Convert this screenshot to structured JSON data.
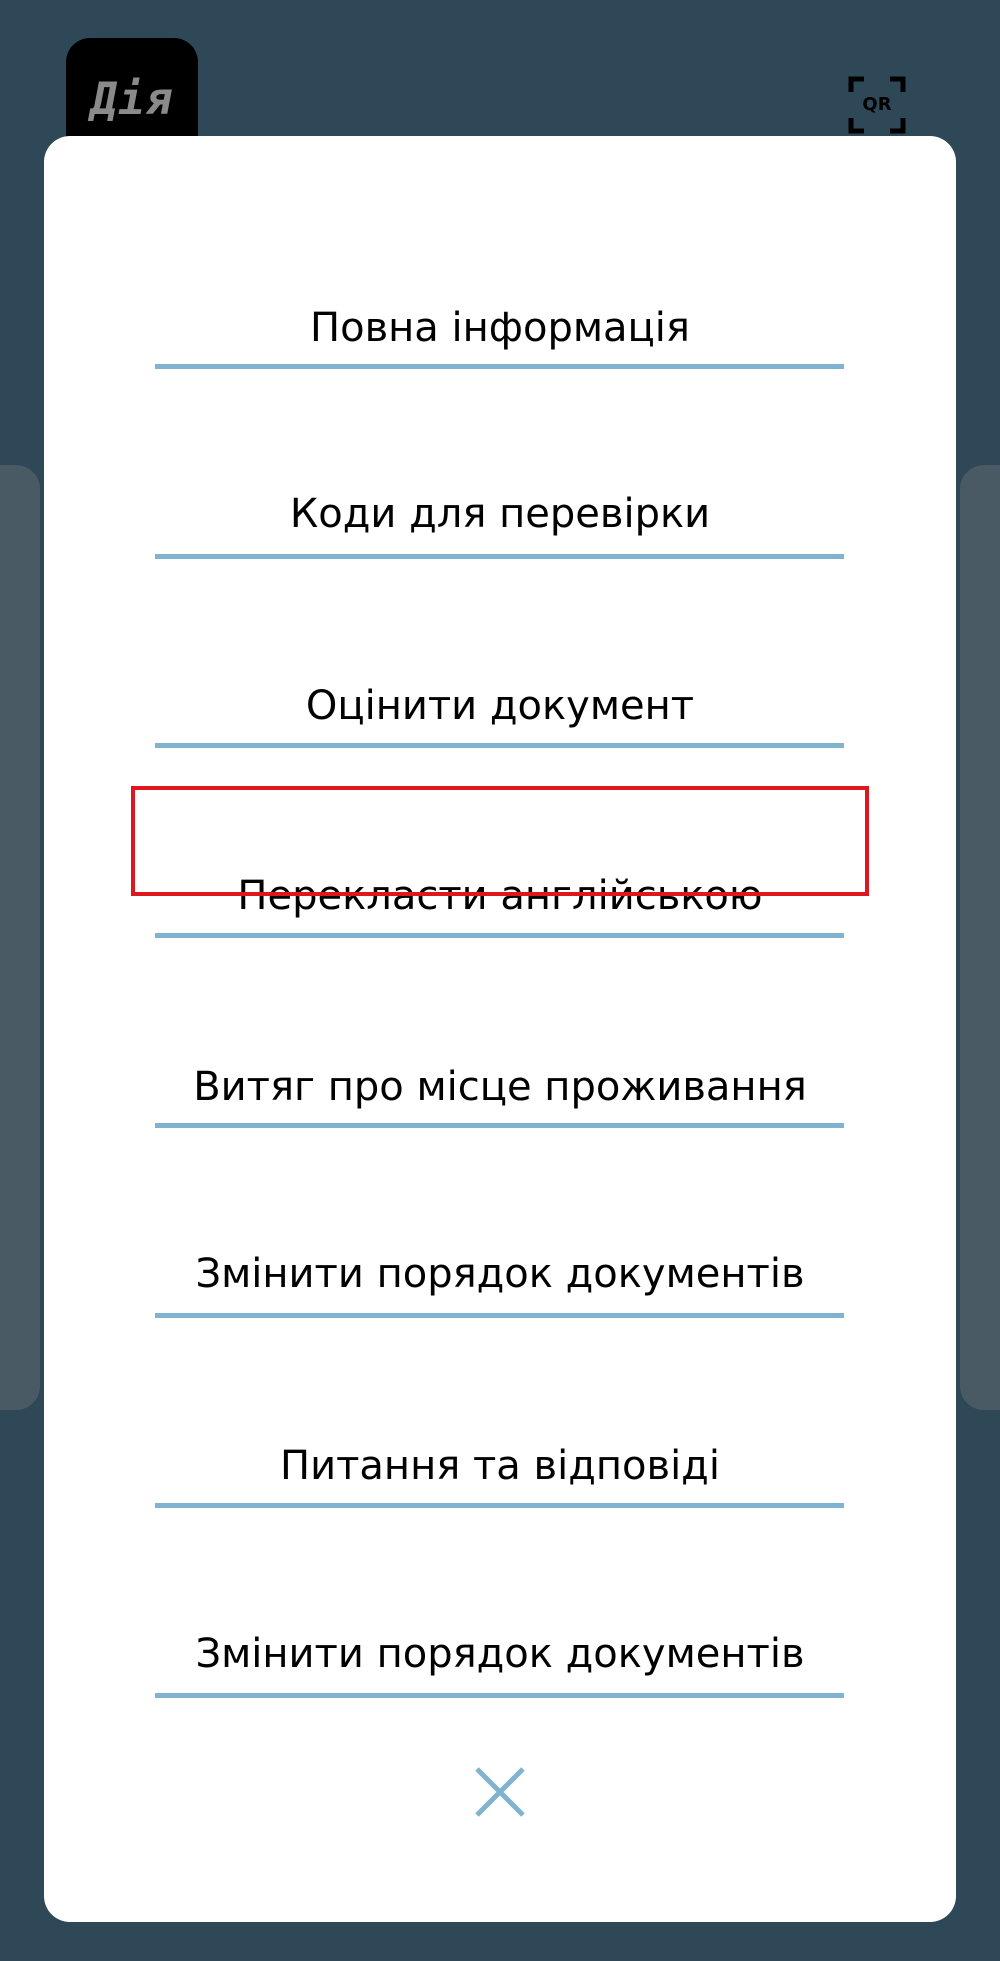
{
  "app": {
    "logo_text": "Дія",
    "qr_label": "QR"
  },
  "menu": {
    "items": [
      {
        "label": "Повна інформація"
      },
      {
        "label": "Коди для перевірки"
      },
      {
        "label": "Оцінити документ"
      },
      {
        "label": "Перекласти англійською",
        "highlighted": true
      },
      {
        "label": "Витяг про місце проживання"
      },
      {
        "label": "Змінити порядок документів"
      },
      {
        "label": "Питання та відповіді"
      },
      {
        "label": "Змінити порядок документів"
      }
    ],
    "close_icon": "close-icon"
  },
  "colors": {
    "background": "#2f4858",
    "sheet": "#ffffff",
    "divider": "#7fb3cf",
    "highlight_border": "#e0161f",
    "close_icon": "#7fb3cf"
  }
}
